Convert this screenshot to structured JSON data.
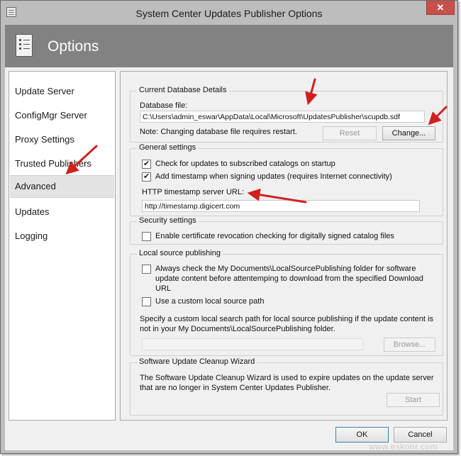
{
  "window": {
    "title": "System Center Updates Publisher Options",
    "close_glyph": "✕"
  },
  "banner": {
    "title": "Options",
    "icon": "checklist-icon"
  },
  "sidebar": {
    "items": [
      {
        "label": "Update Server"
      },
      {
        "label": "ConfigMgr Server"
      },
      {
        "label": "Proxy Settings"
      },
      {
        "label": "Trusted Publishers"
      },
      {
        "label": "Advanced",
        "selected": true
      },
      {
        "label": "Updates"
      },
      {
        "label": "Logging"
      }
    ]
  },
  "database": {
    "group_label": "Current Database Details",
    "file_label": "Database file:",
    "file_value": "C:\\Users\\admin_eswar\\AppData\\Local\\Microsoft\\UpdatesPublisher\\scupdb.sdf",
    "note": "Note: Changing database file requires restart.",
    "reset_label": "Reset",
    "change_label": "Change..."
  },
  "general": {
    "group_label": "General settings",
    "check_updates_label": "Check for updates to subscribed catalogs on startup",
    "check_updates_checked": true,
    "add_timestamp_label": "Add timestamp when signing updates (requires Internet connectivity)",
    "add_timestamp_checked": true,
    "timestamp_url_label": "HTTP timestamp server URL:",
    "timestamp_url_value": "http://timestamp.digicert.com"
  },
  "security": {
    "group_label": "Security settings",
    "revocation_label": "Enable certificate revocation checking for digitally signed catalog files",
    "revocation_checked": false
  },
  "local_source": {
    "group_label": "Local source publishing",
    "always_check_label": "Always check the My Documents\\LocalSourcePublishing folder for software update content before attentemping to download from the specified Download URL",
    "always_check_checked": false,
    "custom_path_label": "Use a custom local source path",
    "custom_path_checked": false,
    "description": "Specify a custom local search path for local source publishing if the update content is not in your My Documents\\LocalSourcePublishing folder.",
    "path_value": "",
    "browse_label": "Browse..."
  },
  "cleanup": {
    "group_label": "Software Update Cleanup Wizard",
    "description": "The Software Update Cleanup Wizard is used to expire updates on the update server that are no longer in System Center Updates Publisher.",
    "start_label": "Start"
  },
  "footer": {
    "ok_label": "OK",
    "cancel_label": "Cancel"
  },
  "watermark": "www.eskonr.com",
  "colors": {
    "annotation_arrow": "#d11f1f",
    "banner": "#828282",
    "titlebar": "#bdbdbd",
    "close_button": "#c7504b"
  }
}
